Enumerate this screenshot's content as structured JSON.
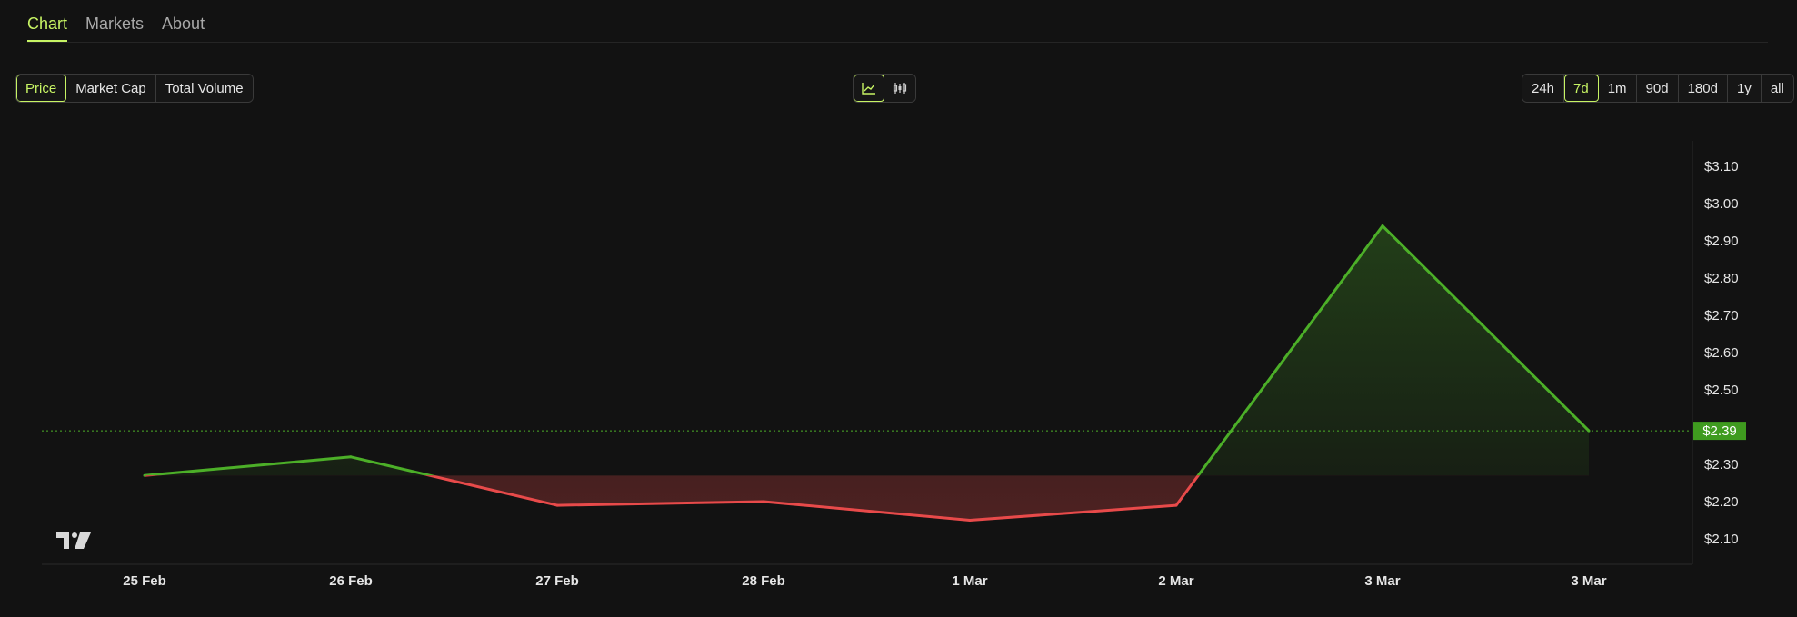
{
  "tabs": [
    {
      "label": "Chart",
      "active": true
    },
    {
      "label": "Markets",
      "active": false
    },
    {
      "label": "About",
      "active": false
    }
  ],
  "metric_buttons": [
    {
      "label": "Price",
      "active": true
    },
    {
      "label": "Market Cap",
      "active": false
    },
    {
      "label": "Total Volume",
      "active": false
    }
  ],
  "view_buttons": [
    {
      "icon": "line-chart-icon",
      "active": true
    },
    {
      "icon": "candlestick-icon",
      "active": false
    }
  ],
  "range_buttons": [
    {
      "label": "24h",
      "active": false
    },
    {
      "label": "7d",
      "active": true
    },
    {
      "label": "1m",
      "active": false
    },
    {
      "label": "90d",
      "active": false
    },
    {
      "label": "180d",
      "active": false
    },
    {
      "label": "1y",
      "active": false
    },
    {
      "label": "all",
      "active": false
    }
  ],
  "colors": {
    "accent": "#c7f464",
    "up": "#4caf28",
    "down": "#e84a4a",
    "badge": "#3f9b1f"
  },
  "chart_data": {
    "type": "line",
    "x": [
      "25 Feb",
      "26 Feb",
      "27 Feb",
      "28 Feb",
      "1 Mar",
      "2 Mar",
      "3 Mar",
      "3 Mar"
    ],
    "x_bold": [
      false,
      false,
      false,
      false,
      true,
      false,
      false,
      false
    ],
    "values": [
      2.27,
      2.32,
      2.19,
      2.2,
      2.15,
      2.19,
      2.94,
      2.39
    ],
    "baseline": 2.27,
    "current_price": 2.39,
    "current_price_label": "$2.39",
    "y_ticks": [
      "$2.10",
      "$2.20",
      "$2.30",
      "$2.50",
      "$2.60",
      "$2.70",
      "$2.80",
      "$2.90",
      "$3.00",
      "$3.10"
    ],
    "y_tick_values": [
      2.1,
      2.2,
      2.3,
      2.5,
      2.6,
      2.7,
      2.8,
      2.9,
      3.0,
      3.1
    ],
    "ylim": [
      2.05,
      3.15
    ],
    "grid": false,
    "logo_icon": "tradingview-logo-icon"
  }
}
